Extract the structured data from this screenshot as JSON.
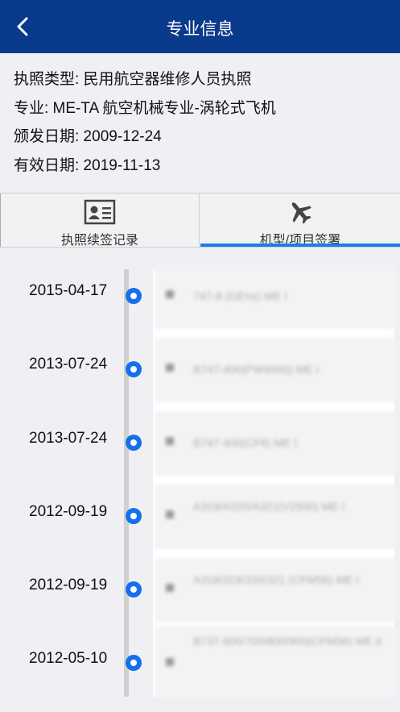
{
  "header": {
    "title": "专业信息"
  },
  "info": {
    "license_type": "执照类型: 民用航空器维修人员执照",
    "specialty": "专业: ME-TA 航空机械专业-涡轮式飞机",
    "issue_date": "颁发日期: 2009-12-24",
    "valid_date": "有效日期: 2019-11-13"
  },
  "tabs": [
    {
      "label": "执照续签记录",
      "icon": "id-card-icon",
      "active": false
    },
    {
      "label": "机型/项目签署",
      "icon": "airplane-icon",
      "active": true
    }
  ],
  "accent_color": "#1a7ee8",
  "navbar_color": "#0a3a8c",
  "records": [
    {
      "date": "2015-04-17",
      "text": "747-8 (GEnx) ME I"
    },
    {
      "date": "2013-07-24",
      "text": "B747-400(PW4000) ME I"
    },
    {
      "date": "2013-07-24",
      "text": "B747-400(CF6) ME I"
    },
    {
      "date": "2012-09-19",
      "text": "A319/A320/A321(V2500) ME I"
    },
    {
      "date": "2012-09-19",
      "text": "A318/319/320/321 (CFM56) ME I"
    },
    {
      "date": "2012-05-10",
      "text": "B737-600/700/800/900(CFM56) ME II"
    }
  ]
}
